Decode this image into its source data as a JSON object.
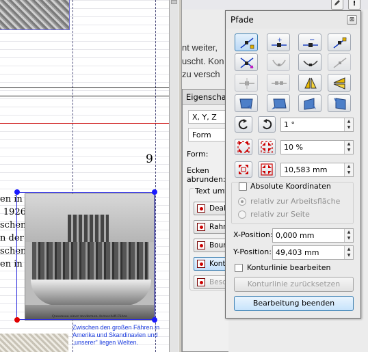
{
  "document": {
    "page_number": "9",
    "body_text_lines": [
      "en  in",
      "1926",
      "schen",
      "n  der",
      "schen",
      "en  in"
    ],
    "image_caption_small": "Queensee einer modernen Autoschiff-Fähre",
    "caption": "Zwischen den großen Fähren in Amerika und Skandinavien und „unserer\" liegen Welten."
  },
  "right_area": {
    "background_text_lines": [
      "nt weiter,",
      "uscht. Kon",
      "zu versch"
    ],
    "toolbar_icons": [
      "pencil-icon",
      "info-icon"
    ]
  },
  "properties_panel": {
    "title": "Eigenschaften",
    "field1": "X, Y, Z",
    "field2": "Form",
    "form_label": "Form:",
    "corners_label": "Ecken abrunden:",
    "textflow_legend": "Text umfließt",
    "textflow_options": [
      "Deaktiviert",
      "Rahmenhöhe",
      "Boundingbox",
      "Konturlinie",
      "Beschnittpfad"
    ]
  },
  "paths_panel": {
    "title": "Pfade",
    "close_symbol": "⊠",
    "rotation_value": "1 °",
    "scale_percent_value": "10 %",
    "scale_mm_value": "10,583 mm",
    "absolute_coords_label": "Absolute Koordinaten",
    "relative_workspace_label": "relativ zur Arbeitsfläche",
    "relative_page_label": "relativ zur Seite",
    "x_position_label": "X-Position:",
    "x_position_value": "0,000 mm",
    "y_position_label": "Y-Position:",
    "y_position_value": "49,403 mm",
    "edit_contour_label": "Konturlinie bearbeiten",
    "reset_contour_label": "Konturlinie zurücksetzen",
    "finish_edit_label": "Bearbeitung beenden",
    "spin_up": "▲",
    "spin_down": "▼"
  },
  "colors": {
    "selection_blue": "#1a1aff",
    "first_handle_red": "#e00000",
    "caption_blue": "#1f3fdf",
    "active_tool_blue": "#b9d7f5"
  }
}
